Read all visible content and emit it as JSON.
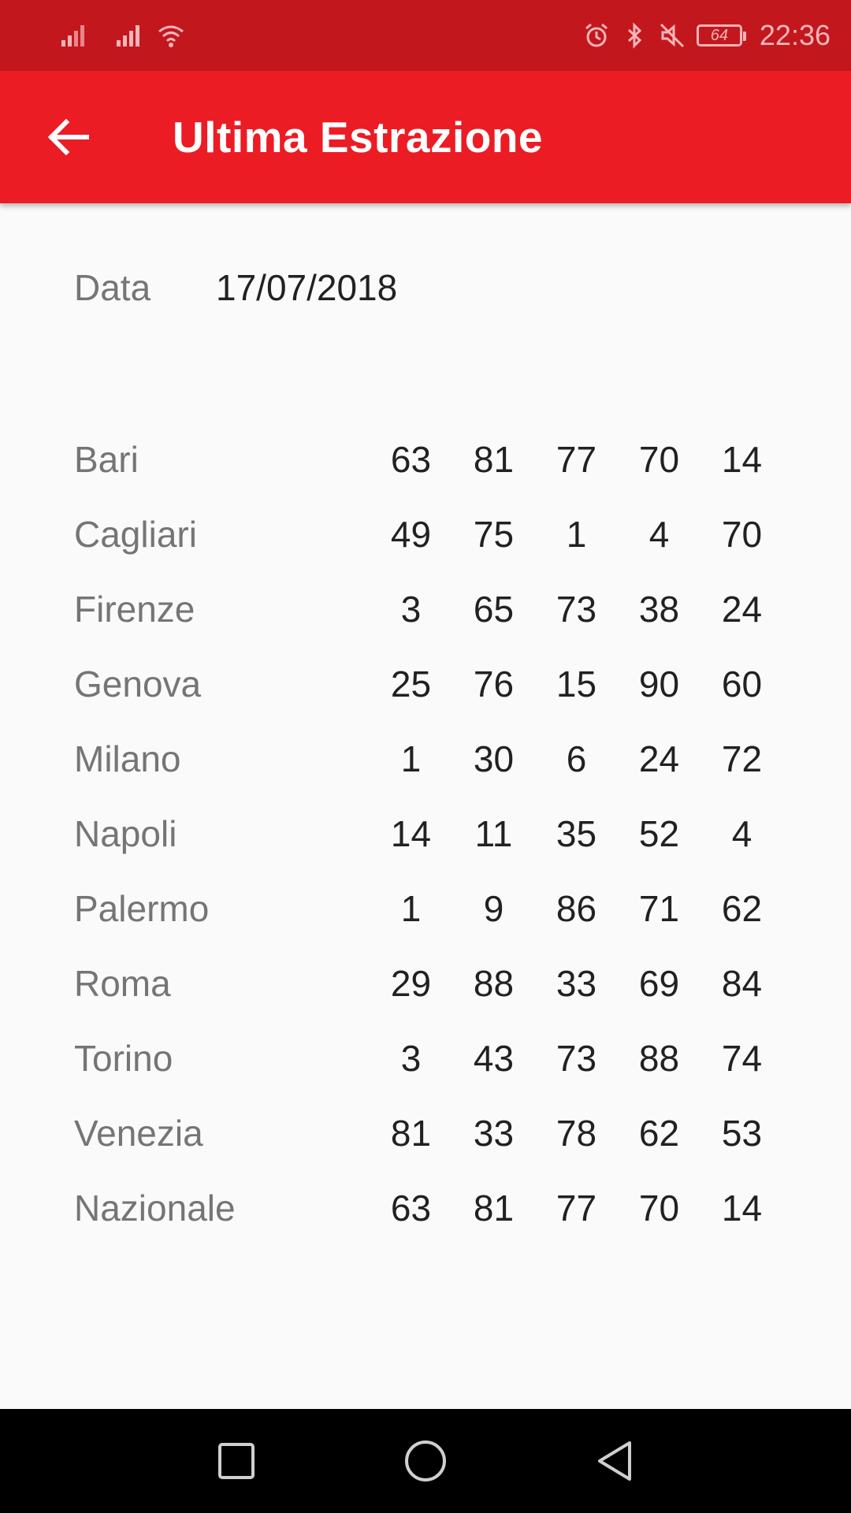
{
  "status_bar": {
    "time": "22:36",
    "battery": "64"
  },
  "app_bar": {
    "title": "Ultima Estrazione"
  },
  "date": {
    "label": "Data",
    "value": "17/07/2018"
  },
  "results": [
    {
      "city": "Bari",
      "numbers": [
        "63",
        "81",
        "77",
        "70",
        "14"
      ]
    },
    {
      "city": "Cagliari",
      "numbers": [
        "49",
        "75",
        "1",
        "4",
        "70"
      ]
    },
    {
      "city": "Firenze",
      "numbers": [
        "3",
        "65",
        "73",
        "38",
        "24"
      ]
    },
    {
      "city": "Genova",
      "numbers": [
        "25",
        "76",
        "15",
        "90",
        "60"
      ]
    },
    {
      "city": "Milano",
      "numbers": [
        "1",
        "30",
        "6",
        "24",
        "72"
      ]
    },
    {
      "city": "Napoli",
      "numbers": [
        "14",
        "11",
        "35",
        "52",
        "4"
      ]
    },
    {
      "city": "Palermo",
      "numbers": [
        "1",
        "9",
        "86",
        "71",
        "62"
      ]
    },
    {
      "city": "Roma",
      "numbers": [
        "29",
        "88",
        "33",
        "69",
        "84"
      ]
    },
    {
      "city": "Torino",
      "numbers": [
        "3",
        "43",
        "73",
        "88",
        "74"
      ]
    },
    {
      "city": "Venezia",
      "numbers": [
        "81",
        "33",
        "78",
        "62",
        "53"
      ]
    },
    {
      "city": "Nazionale",
      "numbers": [
        "63",
        "81",
        "77",
        "70",
        "14"
      ]
    }
  ],
  "icons": {
    "back": "arrow-back-icon",
    "nav_recents": "square-icon",
    "nav_home": "circle-icon",
    "nav_back": "triangle-icon"
  },
  "colors": {
    "status_bar": "#c3171e",
    "app_bar": "#ec1c24",
    "background": "#fafafa"
  }
}
